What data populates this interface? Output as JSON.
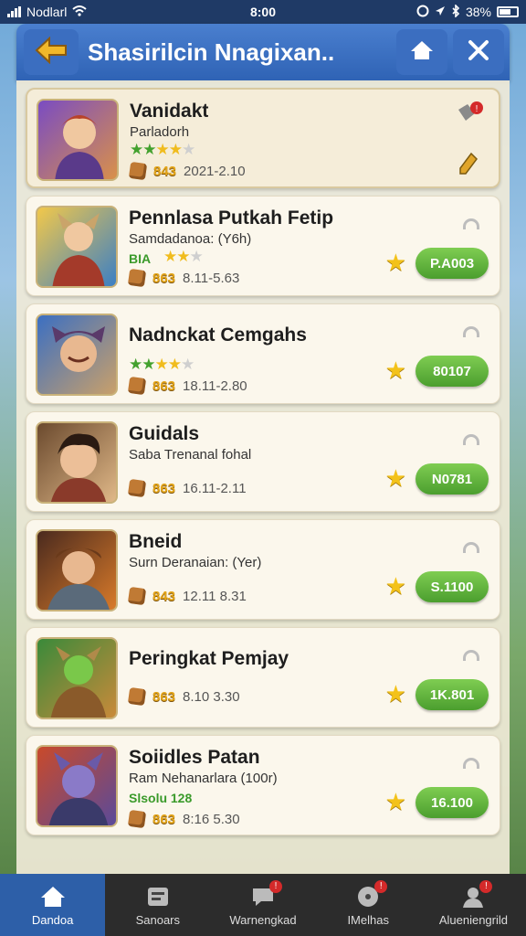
{
  "status_bar": {
    "carrier": "Nodlarl",
    "time": "8:00",
    "battery": "38%"
  },
  "header": {
    "title": "Shasirilcin Nnagixan.."
  },
  "cards": [
    {
      "title": "Vanidakt",
      "subtitle": "Parladorh",
      "green": "",
      "gold": "843",
      "date": "2021-2.10",
      "button": "",
      "colors": [
        "#7a4cc2",
        "#d9904a"
      ]
    },
    {
      "title": "Pennlasa Putkah Fetip",
      "subtitle": "Samdadanoa: (Y6h)",
      "green": "BIA",
      "gold": "863",
      "date": "8.11-5.63",
      "button": "P.A003",
      "colors": [
        "#f2c84a",
        "#3b7fc4"
      ]
    },
    {
      "title": "Nadnckat Cemgahs",
      "subtitle": "",
      "green": "",
      "gold": "863",
      "date": "18.11-2.80",
      "button": "80107",
      "colors": [
        "#3b6fc2",
        "#c9a06a"
      ]
    },
    {
      "title": "Guidals",
      "subtitle": "Saba Trenanal fohal",
      "green": "",
      "gold": "863",
      "date": "16.11-2.11",
      "button": "N0781",
      "colors": [
        "#6b4a2e",
        "#e0b888"
      ]
    },
    {
      "title": "Bneid",
      "subtitle": "Surn Deranaian: (Yer)",
      "green": "",
      "gold": "843",
      "date": "12.11 8.31",
      "button": "S.1100",
      "colors": [
        "#4a2a1e",
        "#d87a2a"
      ]
    },
    {
      "title": "Peringkat Pemjay",
      "subtitle": "",
      "green": "",
      "gold": "863",
      "date": "8.10 3.30",
      "button": "1K.801",
      "colors": [
        "#3a8a3a",
        "#c98a3a"
      ]
    },
    {
      "title": "Soiidles Patan",
      "subtitle": "Ram Nehanarlara (100r)",
      "green": "Slsolu 128",
      "gold": "863",
      "date": "8:16 5.30",
      "button": "16.100",
      "colors": [
        "#c94a2a",
        "#5a4a9a"
      ]
    }
  ],
  "nav": [
    {
      "label": "Dandoa",
      "icon": "home-icon"
    },
    {
      "label": "Sanoars",
      "icon": "list-icon"
    },
    {
      "label": "Warnengkad",
      "icon": "chat-icon"
    },
    {
      "label": "IMelhas",
      "icon": "disc-icon"
    },
    {
      "label": "Alueniengrild",
      "icon": "user-icon"
    }
  ]
}
